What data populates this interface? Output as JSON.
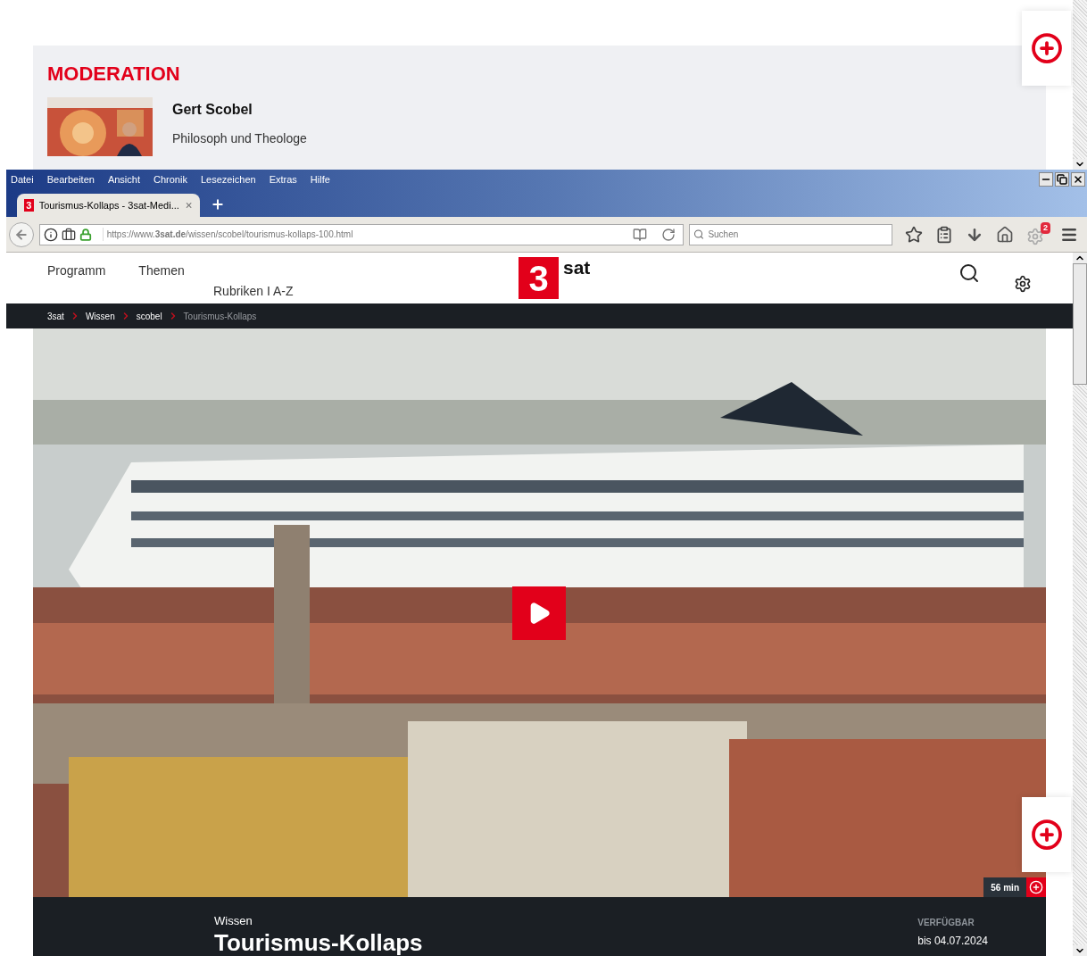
{
  "top_panel": {
    "heading": "MODERATION",
    "presenter": {
      "name": "Gert Scobel",
      "role": "Philosoph und Theologe"
    }
  },
  "browser": {
    "menu": [
      "Datei",
      "Bearbeiten",
      "Ansicht",
      "Chronik",
      "Lesezeichen",
      "Extras",
      "Hilfe"
    ],
    "tabs": [
      {
        "favicon": "3",
        "title": "Tourismus-Kollaps - 3sat-Medi...",
        "selected": true
      }
    ],
    "url": "https://www.**3sat.de**/wissen/scobel/tourismus-kollaps-100.html",
    "search": {
      "placeholder": "Suchen"
    },
    "notification_count": "2"
  },
  "site": {
    "nav": [
      "Programm",
      "Themen"
    ],
    "nav_sub": "Rubriken I A-Z",
    "logo_digit": "3",
    "logo_text": "sat",
    "breadcrumb": [
      {
        "label": "3sat",
        "current": false
      },
      {
        "label": "Wissen",
        "current": false
      },
      {
        "label": "scobel",
        "current": false
      },
      {
        "label": "Tourismus-Kollaps",
        "current": true
      }
    ],
    "video": {
      "kind": "picture",
      "duration": "56 min"
    },
    "info": {
      "category": "Wissen",
      "title": "Tourismus-Kollaps",
      "availability_label": "VERFÜGBAR",
      "availability": "bis 04.07.2024"
    }
  }
}
